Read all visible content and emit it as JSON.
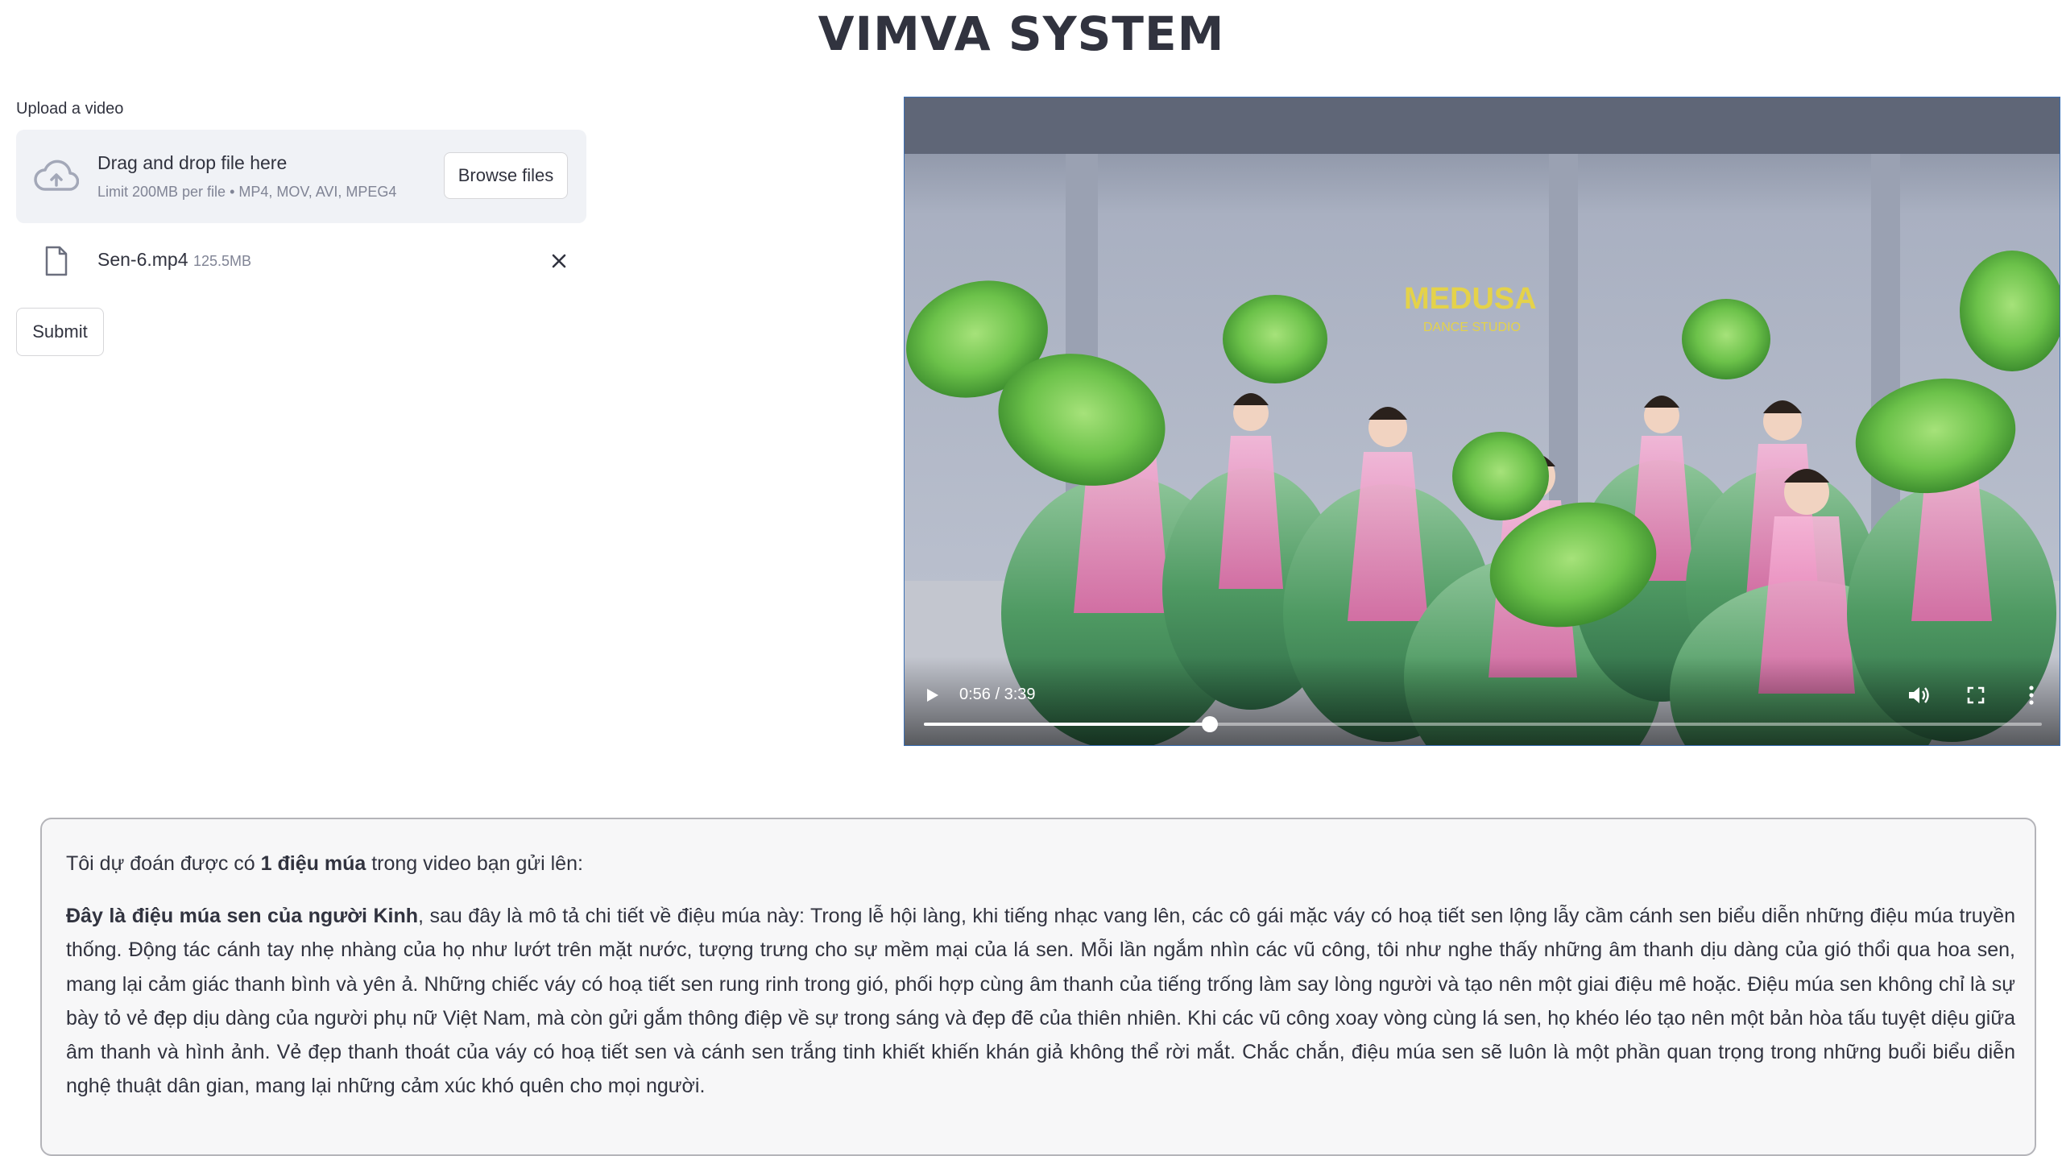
{
  "app": {
    "title": "VIMVA SYSTEM"
  },
  "uploader": {
    "label": "Upload a video",
    "dropzone_text": "Drag and drop file here",
    "limit_text": "Limit 200MB per file • MP4, MOV, AVI, MPEG4",
    "browse_label": "Browse files",
    "icon": "cloud-upload-icon"
  },
  "uploaded_file": {
    "name": "Sen-6.mp4",
    "size": "125.5MB",
    "icon": "file-icon",
    "remove_icon": "close-icon"
  },
  "submit_label": "Submit",
  "video": {
    "time_display": "0:56 / 3:39",
    "watermark_brand": "MEDUSA",
    "watermark_sub": "DANCE STUDIO",
    "progress_fraction": 0.2557,
    "controls": [
      "play-icon",
      "volume-icon",
      "fullscreen-icon",
      "more-options-icon"
    ]
  },
  "result": {
    "intro_prefix": "Tôi dự đoán được có ",
    "intro_bold": "1 điệu múa",
    "intro_suffix": " trong video bạn gửi lên:",
    "desc_bold": "Đây là điệu múa sen của người Kinh",
    "desc_text": ", sau đây là mô tả chi tiết về điệu múa này: Trong lễ hội làng, khi tiếng nhạc vang lên, các cô gái mặc váy có hoạ tiết sen lộng lẫy cầm cánh sen biểu diễn những điệu múa truyền thống. Động tác cánh tay nhẹ nhàng của họ như lướt trên mặt nước, tượng trưng cho sự mềm mại của lá sen. Mỗi lần ngắm nhìn các vũ công, tôi như nghe thấy những âm thanh dịu dàng của gió thổi qua hoa sen, mang lại cảm giác thanh bình và yên ả. Những chiếc váy có hoạ tiết sen rung rinh trong gió, phối hợp cùng âm thanh của tiếng trống làm say lòng người và tạo nên một giai điệu mê hoặc. Điệu múa sen không chỉ là sự bày tỏ vẻ đẹp dịu dàng của người phụ nữ Việt Nam, mà còn gửi gắm thông điệp về sự trong sáng và đẹp đẽ của thiên nhiên. Khi các vũ công xoay vòng cùng lá sen, họ khéo léo tạo nên một bản hòa tấu tuyệt diệu giữa âm thanh và hình ảnh. Vẻ đẹp thanh thoát của váy có hoạ tiết sen và cánh sen trắng tinh khiết khiến khán giả không thể rời mắt. Chắc chắn, điệu múa sen sẽ luôn là một phần quan trọng trong những buổi biểu diễn nghệ thuật dân gian, mang lại những cảm xúc khó quên cho mọi người."
  },
  "colors": {
    "text": "#31333f",
    "muted": "#808495",
    "dropzone_bg": "#f0f2f6",
    "result_bg": "#f7f7f8",
    "lotus_pink": "#e88fc0",
    "leaf_green": "#6cc24a"
  }
}
